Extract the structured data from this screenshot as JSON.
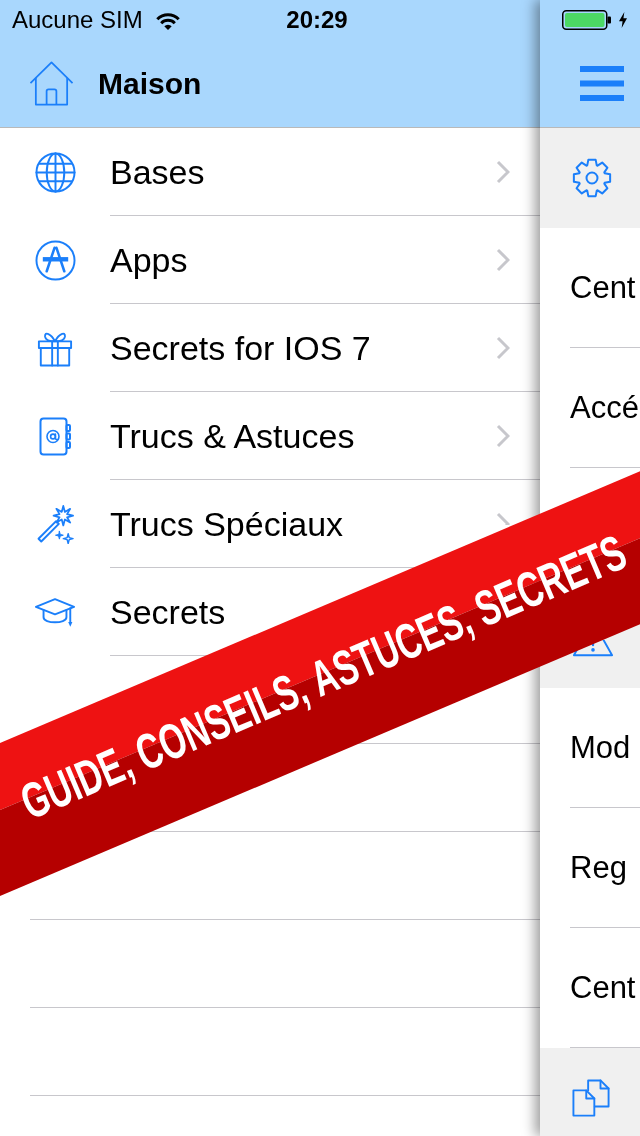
{
  "status_bar": {
    "carrier": "Aucune SIM",
    "time": "20:29"
  },
  "menu": {
    "title": "Maison",
    "items": [
      {
        "label": "Bases"
      },
      {
        "label": "Apps"
      },
      {
        "label": "Secrets for IOS 7"
      },
      {
        "label": "Trucs & Astuces"
      },
      {
        "label": "Trucs Spéciaux"
      },
      {
        "label": "Secrets"
      }
    ]
  },
  "main_panel": {
    "sections": [
      {
        "rows": [
          {
            "label": "Cent"
          },
          {
            "label": "Accé"
          }
        ]
      },
      {
        "rows": [
          {
            "label": "Mod"
          },
          {
            "label": "Reg"
          },
          {
            "label": "Cent"
          }
        ]
      }
    ]
  },
  "banner": {
    "words": [
      "GUIDE,",
      "CONSEILS,",
      "ASTUCES,",
      "SECRETS"
    ]
  }
}
